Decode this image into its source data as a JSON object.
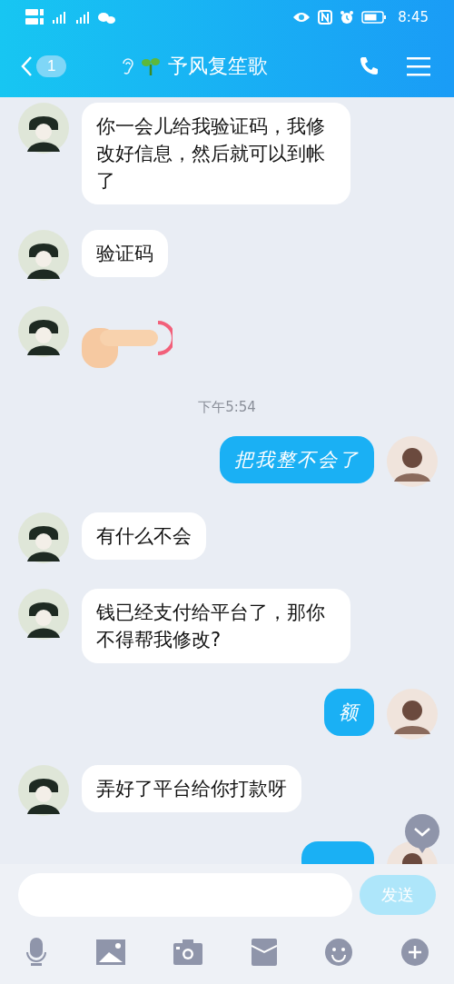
{
  "status_bar": {
    "time": "8:45"
  },
  "header": {
    "unread_count": "1",
    "title": "予风复笙歌"
  },
  "messages": [
    {
      "kind": "text",
      "outgoing": false,
      "text": "你一会儿给我验证码，我修改好信息，然后就可以到帐了"
    },
    {
      "kind": "text",
      "outgoing": false,
      "text": "验证码"
    },
    {
      "kind": "sticker",
      "outgoing": false
    },
    {
      "kind": "time",
      "text": "下午5:54"
    },
    {
      "kind": "text",
      "outgoing": true,
      "text": "把我整不会了"
    },
    {
      "kind": "text",
      "outgoing": false,
      "text": "有什么不会"
    },
    {
      "kind": "text",
      "outgoing": false,
      "text": "钱已经支付给平台了，那你不得帮我修改?"
    },
    {
      "kind": "text",
      "outgoing": true,
      "text": "额"
    },
    {
      "kind": "text",
      "outgoing": false,
      "text": "弄好了平台给你打款呀"
    },
    {
      "kind": "partial",
      "outgoing": true
    }
  ],
  "composer": {
    "send_label": "发送",
    "send_disabled": true
  }
}
